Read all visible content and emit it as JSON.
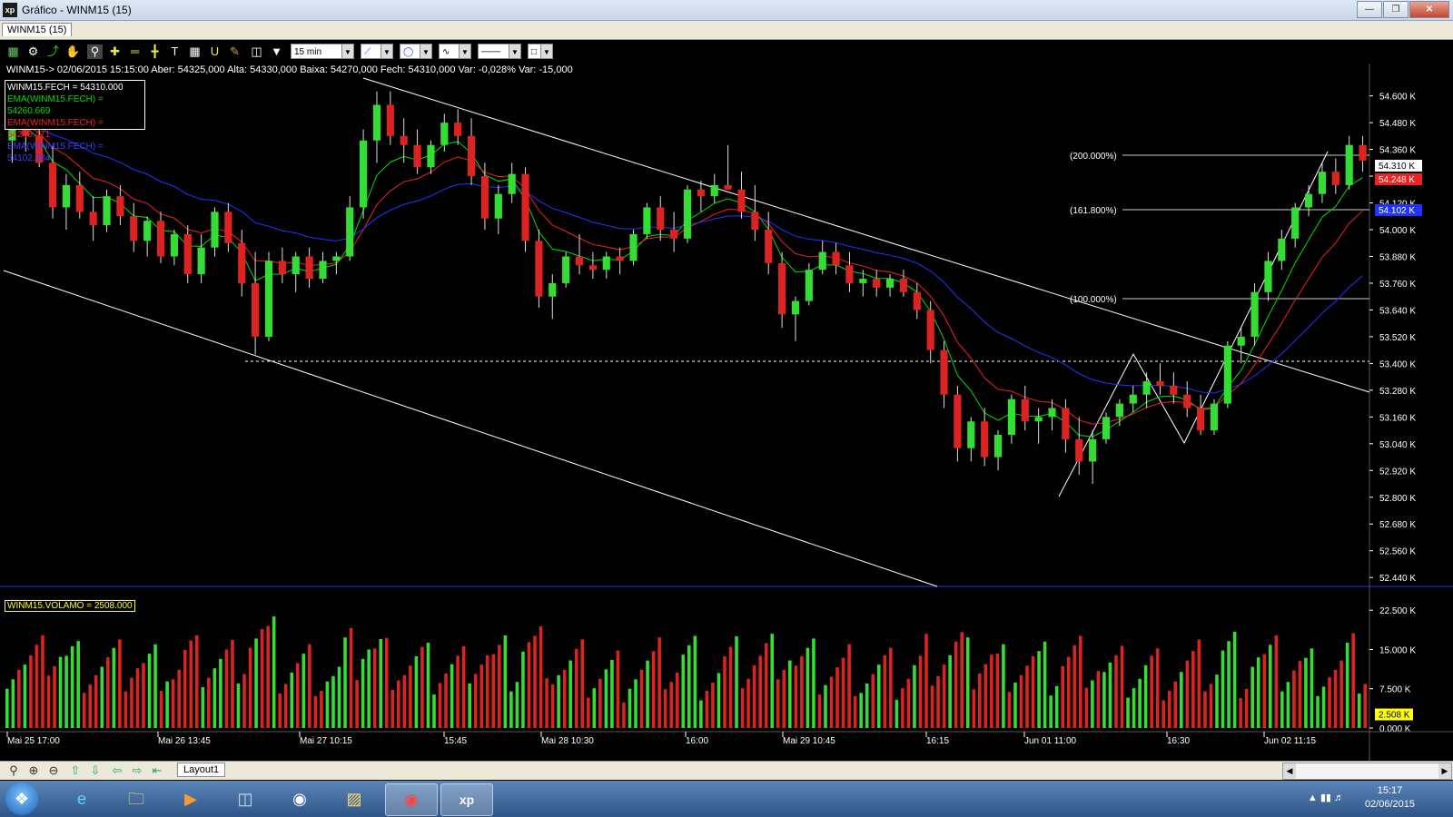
{
  "window": {
    "title": "Gráfico - WINM15 (15)",
    "tab": "WINM15 (15)"
  },
  "toolbar": {
    "interval": "15 min"
  },
  "infobar": "WINM15-> 02/06/2015 15:15:00 Aber: 54325,000 Alta: 54330,000 Baixa: 54270,000 Fech: 54310,000 Var: -0,028% Var: -15,000",
  "legend": [
    {
      "text": "WINM15.FECH = 54310.000",
      "color": "#ffffff"
    },
    {
      "text": "EMA(WINM15.FECH) = 54260.669",
      "color": "#00dd00"
    },
    {
      "text": "EMA(WINM15.FECH) = 54248.471",
      "color": "#ee2222"
    },
    {
      "text": "EMA(WINM15.FECH) = 54102.384",
      "color": "#3344ff"
    }
  ],
  "price_axis": [
    "54.600 K",
    "54.480 K",
    "54.360 K",
    "54.240 K",
    "54.120 K",
    "54.000 K",
    "53.880 K",
    "53.760 K",
    "53.640 K",
    "53.520 K",
    "53.400 K",
    "53.280 K",
    "53.160 K",
    "53.040 K",
    "52.920 K",
    "52.800 K",
    "52.680 K",
    "52.560 K",
    "52.440 K"
  ],
  "price_tags": [
    {
      "text": "54.310 K",
      "bg": "#ffffff",
      "fg": "#000000"
    },
    {
      "text": "54.248 K",
      "bg": "#ee2222",
      "fg": "#ffffff"
    },
    {
      "text": "54.102 K",
      "bg": "#2233ff",
      "fg": "#ffffff"
    }
  ],
  "fib_levels": [
    "(200.000%)",
    "(161.800%)",
    "(100.000%)"
  ],
  "volume": {
    "label": "WINM15.VOLAMO = 2508.000",
    "axis": [
      "22.500 K",
      "15.000 K",
      "7.500 K",
      "0.000 K"
    ],
    "tag": "2.508 K"
  },
  "time_axis": [
    "Mai 25 17:00",
    "Mai 26 13:45",
    "Mai 27 10:15",
    "15:45",
    "Mai 28 10:30",
    "16:00",
    "Mai 29 10:45",
    "16:15",
    "Jun 01 11:00",
    "16:30",
    "Jun 02 11:15"
  ],
  "bottom": {
    "layout_tab": "Layout1"
  },
  "taskbar": {
    "time": "15:17",
    "date": "02/06/2015"
  },
  "colors": {
    "up": "#33dd33",
    "down": "#dd2222",
    "ema_fast": "#00dd00",
    "ema_mid": "#ee2222",
    "ema_slow": "#2233ff"
  },
  "chart_data": {
    "type": "candlestick",
    "symbol": "WINM15",
    "interval": "15 min",
    "ylim": [
      52400,
      54680
    ],
    "last_close": 54310,
    "ema_values": [
      54260.669,
      54248.471,
      54102.384
    ],
    "candles": [
      [
        54400,
        54550,
        54300,
        54480
      ],
      [
        54480,
        54560,
        54350,
        54420
      ],
      [
        54420,
        54500,
        54280,
        54300
      ],
      [
        54300,
        54380,
        54050,
        54100
      ],
      [
        54100,
        54250,
        54000,
        54200
      ],
      [
        54200,
        54260,
        54050,
        54080
      ],
      [
        54080,
        54150,
        53950,
        54020
      ],
      [
        54020,
        54180,
        53990,
        54150
      ],
      [
        54150,
        54200,
        54020,
        54060
      ],
      [
        54060,
        54120,
        53900,
        53950
      ],
      [
        53950,
        54060,
        53880,
        54040
      ],
      [
        54040,
        54080,
        53850,
        53880
      ],
      [
        53880,
        54000,
        53840,
        53980
      ],
      [
        53980,
        54020,
        53760,
        53800
      ],
      [
        53800,
        53980,
        53760,
        53920
      ],
      [
        53920,
        54100,
        53880,
        54080
      ],
      [
        54080,
        54120,
        53900,
        53940
      ],
      [
        53940,
        54000,
        53700,
        53760
      ],
      [
        53760,
        53900,
        53440,
        53520
      ],
      [
        53520,
        53900,
        53500,
        53860
      ],
      [
        53860,
        53920,
        53760,
        53800
      ],
      [
        53800,
        53900,
        53720,
        53880
      ],
      [
        53880,
        53920,
        53740,
        53780
      ],
      [
        53780,
        53900,
        53760,
        53860
      ],
      [
        53860,
        53900,
        53800,
        53880
      ],
      [
        53880,
        54150,
        53860,
        54100
      ],
      [
        54100,
        54450,
        54050,
        54400
      ],
      [
        54400,
        54620,
        54300,
        54560
      ],
      [
        54560,
        54620,
        54380,
        54420
      ],
      [
        54420,
        54500,
        54300,
        54380
      ],
      [
        54380,
        54450,
        54250,
        54280
      ],
      [
        54280,
        54400,
        54250,
        54380
      ],
      [
        54380,
        54520,
        54350,
        54480
      ],
      [
        54480,
        54540,
        54380,
        54420
      ],
      [
        54420,
        54500,
        54200,
        54240
      ],
      [
        54240,
        54300,
        54000,
        54050
      ],
      [
        54050,
        54200,
        53980,
        54160
      ],
      [
        54160,
        54300,
        54120,
        54250
      ],
      [
        54250,
        54280,
        53900,
        53950
      ],
      [
        53950,
        54000,
        53650,
        53700
      ],
      [
        53700,
        53800,
        53600,
        53760
      ],
      [
        53760,
        53900,
        53740,
        53880
      ],
      [
        53880,
        53980,
        53800,
        53840
      ],
      [
        53840,
        53900,
        53780,
        53820
      ],
      [
        53820,
        53900,
        53780,
        53880
      ],
      [
        53880,
        53920,
        53800,
        53860
      ],
      [
        53860,
        54000,
        53840,
        53980
      ],
      [
        53980,
        54120,
        53960,
        54100
      ],
      [
        54100,
        54150,
        53950,
        54000
      ],
      [
        54000,
        54080,
        53900,
        53960
      ],
      [
        53960,
        54200,
        53940,
        54180
      ],
      [
        54180,
        54220,
        54080,
        54150
      ],
      [
        54150,
        54250,
        54120,
        54200
      ],
      [
        54200,
        54380,
        54180,
        54180
      ],
      [
        54180,
        54260,
        54050,
        54080
      ],
      [
        54080,
        54200,
        53950,
        54000
      ],
      [
        54000,
        54080,
        53800,
        53850
      ],
      [
        53850,
        53900,
        53560,
        53620
      ],
      [
        53620,
        53700,
        53500,
        53680
      ],
      [
        53680,
        53850,
        53660,
        53820
      ],
      [
        53820,
        53950,
        53800,
        53900
      ],
      [
        53900,
        53940,
        53800,
        53840
      ],
      [
        53840,
        53900,
        53720,
        53760
      ],
      [
        53760,
        53820,
        53700,
        53780
      ],
      [
        53780,
        53820,
        53700,
        53740
      ],
      [
        53740,
        53800,
        53700,
        53780
      ],
      [
        53780,
        53820,
        53700,
        53720
      ],
      [
        53720,
        53760,
        53600,
        53640
      ],
      [
        53640,
        53680,
        53400,
        53460
      ],
      [
        53460,
        53500,
        53200,
        53260
      ],
      [
        53260,
        53300,
        52960,
        53020
      ],
      [
        53020,
        53160,
        52960,
        53140
      ],
      [
        53140,
        53200,
        52940,
        52980
      ],
      [
        52980,
        53100,
        52920,
        53080
      ],
      [
        53080,
        53260,
        53040,
        53240
      ],
      [
        53240,
        53300,
        53100,
        53140
      ],
      [
        53140,
        53200,
        53040,
        53160
      ],
      [
        53160,
        53240,
        53100,
        53200
      ],
      [
        53200,
        53240,
        53000,
        53060
      ],
      [
        53060,
        53160,
        52900,
        52960
      ],
      [
        52960,
        53100,
        52860,
        53060
      ],
      [
        53060,
        53180,
        53040,
        53160
      ],
      [
        53160,
        53240,
        53120,
        53220
      ],
      [
        53220,
        53300,
        53180,
        53260
      ],
      [
        53260,
        53360,
        53200,
        53320
      ],
      [
        53320,
        53400,
        53260,
        53300
      ],
      [
        53300,
        53360,
        53220,
        53260
      ],
      [
        53260,
        53320,
        53160,
        53200
      ],
      [
        53200,
        53260,
        53080,
        53100
      ],
      [
        53100,
        53240,
        53080,
        53220
      ],
      [
        53220,
        53500,
        53200,
        53480
      ],
      [
        53480,
        53560,
        53400,
        53520
      ],
      [
        53520,
        53760,
        53480,
        53720
      ],
      [
        53720,
        53900,
        53680,
        53860
      ],
      [
        53860,
        54000,
        53820,
        53960
      ],
      [
        53960,
        54120,
        53920,
        54100
      ],
      [
        54100,
        54200,
        54060,
        54160
      ],
      [
        54160,
        54300,
        54120,
        54260
      ],
      [
        54260,
        54320,
        54160,
        54200
      ],
      [
        54200,
        54420,
        54180,
        54380
      ],
      [
        54380,
        54420,
        54260,
        54310
      ]
    ],
    "volume_values": []
  }
}
